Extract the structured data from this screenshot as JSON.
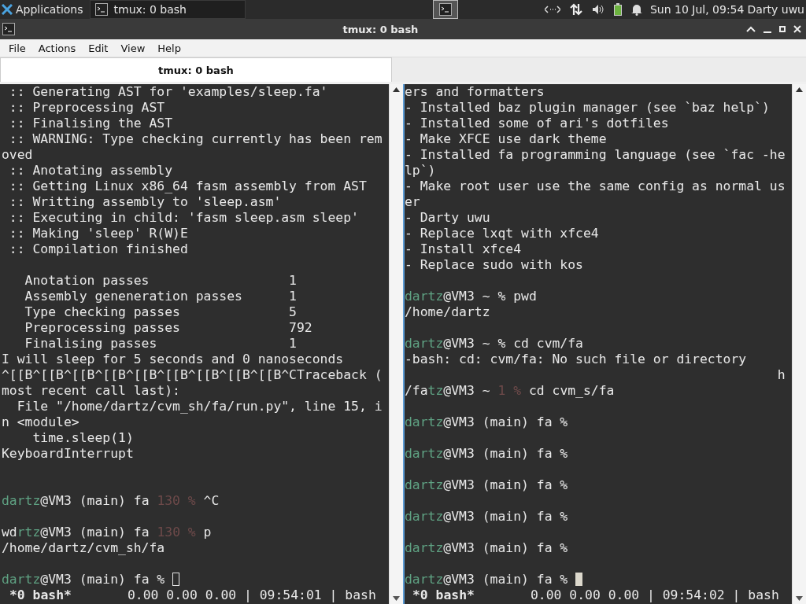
{
  "panel": {
    "apps_label": "Applications",
    "tasks": [
      {
        "label": "tmux: 0 bash"
      }
    ],
    "clock": "Sun 10 Jul, 09:54",
    "user": "Darty uwu"
  },
  "window": {
    "title": "tmux: 0 bash"
  },
  "menu": [
    "File",
    "Actions",
    "Edit",
    "View",
    "Help"
  ],
  "tabs": [
    {
      "label": "tmux: 0 bash",
      "selected": true
    }
  ],
  "panes": [
    {
      "focused": false,
      "lines": [
        {
          "segments": [
            {
              "kind": "plain",
              "text": " :: Generating AST for 'examples/sleep.fa'"
            }
          ]
        },
        {
          "segments": [
            {
              "kind": "plain",
              "text": " :: Preprocessing AST"
            }
          ]
        },
        {
          "segments": [
            {
              "kind": "plain",
              "text": " :: Finalising the AST"
            }
          ]
        },
        {
          "segments": [
            {
              "kind": "plain",
              "text": " :: WARNING: Type checking currently has been rem"
            }
          ]
        },
        {
          "segments": [
            {
              "kind": "plain",
              "text": "oved"
            }
          ]
        },
        {
          "segments": [
            {
              "kind": "plain",
              "text": " :: Anotating assembly"
            }
          ]
        },
        {
          "segments": [
            {
              "kind": "plain",
              "text": " :: Getting Linux x86_64 fasm assembly from AST"
            }
          ]
        },
        {
          "segments": [
            {
              "kind": "plain",
              "text": " :: Writting assembly to 'sleep.asm'"
            }
          ]
        },
        {
          "segments": [
            {
              "kind": "plain",
              "text": " :: Executing in child: 'fasm sleep.asm sleep'"
            }
          ]
        },
        {
          "segments": [
            {
              "kind": "plain",
              "text": " :: Making 'sleep' R(W)E"
            }
          ]
        },
        {
          "segments": [
            {
              "kind": "plain",
              "text": " :: Compilation finished"
            }
          ]
        },
        {
          "kind": "blank"
        },
        {
          "segments": [
            {
              "kind": "plain",
              "text": "   Anotation passes                  1"
            }
          ]
        },
        {
          "segments": [
            {
              "kind": "plain",
              "text": "   Assembly geneneration passes      1"
            }
          ]
        },
        {
          "segments": [
            {
              "kind": "plain",
              "text": "   Type checking passes              5"
            }
          ]
        },
        {
          "segments": [
            {
              "kind": "plain",
              "text": "   Preprocessing passes              792"
            }
          ]
        },
        {
          "segments": [
            {
              "kind": "plain",
              "text": "   Finalising passes                 1"
            }
          ]
        },
        {
          "segments": [
            {
              "kind": "plain",
              "text": "I will sleep for 5 seconds and 0 nanoseconds"
            }
          ]
        },
        {
          "segments": [
            {
              "kind": "plain",
              "text": "^[[B^[[B^[[B^[[B^[[B^[[B^[[B^[[B^[[B^CTraceback ("
            }
          ]
        },
        {
          "segments": [
            {
              "kind": "plain",
              "text": "most recent call last):"
            }
          ]
        },
        {
          "segments": [
            {
              "kind": "plain",
              "text": "  File \"/home/dartz/cvm_sh/fa/run.py\", line 15, i"
            }
          ]
        },
        {
          "segments": [
            {
              "kind": "plain",
              "text": "n <module>"
            }
          ]
        },
        {
          "segments": [
            {
              "kind": "plain",
              "text": "    time.sleep(1)"
            }
          ]
        },
        {
          "segments": [
            {
              "kind": "plain",
              "text": "KeyboardInterrupt"
            }
          ]
        },
        {
          "kind": "blank"
        },
        {
          "kind": "blank"
        },
        {
          "segments": [
            {
              "kind": "user",
              "text": "dartz"
            },
            {
              "kind": "plain",
              "text": "@VM3 (main) fa "
            },
            {
              "kind": "code",
              "text": "130 %"
            },
            {
              "kind": "plain",
              "text": " ^C"
            }
          ]
        },
        {
          "kind": "blank"
        },
        {
          "segments": [
            {
              "kind": "plain",
              "text": "wd"
            },
            {
              "kind": "user",
              "text": "rtz"
            },
            {
              "kind": "plain",
              "text": "@VM3 (main) fa "
            },
            {
              "kind": "code",
              "text": "130 %"
            },
            {
              "kind": "plain",
              "text": " p"
            }
          ]
        },
        {
          "segments": [
            {
              "kind": "plain",
              "text": "/home/dartz/cvm_sh/fa"
            }
          ]
        },
        {
          "kind": "blank"
        },
        {
          "segments": [
            {
              "kind": "user",
              "text": "dartz"
            },
            {
              "kind": "plain",
              "text": "@VM3 (main) fa % "
            }
          ],
          "cursor": true
        }
      ],
      "status": {
        "window": "*0 bash*",
        "info": "0.00 0.00 0.00 | 09:54:01 | bash"
      }
    },
    {
      "focused": true,
      "lines": [
        {
          "segments": [
            {
              "kind": "plain",
              "text": "ers and formatters"
            }
          ]
        },
        {
          "segments": [
            {
              "kind": "plain",
              "text": "- Installed baz plugin manager (see `baz help`)"
            }
          ]
        },
        {
          "segments": [
            {
              "kind": "plain",
              "text": "- Installed some of ari's dotfiles"
            }
          ]
        },
        {
          "segments": [
            {
              "kind": "plain",
              "text": "- Make XFCE use dark theme"
            }
          ]
        },
        {
          "segments": [
            {
              "kind": "plain",
              "text": "- Installed fa programming language (see `fac -he"
            }
          ]
        },
        {
          "segments": [
            {
              "kind": "plain",
              "text": "lp`)"
            }
          ]
        },
        {
          "segments": [
            {
              "kind": "plain",
              "text": "- Make root user use the same config as normal us"
            }
          ]
        },
        {
          "segments": [
            {
              "kind": "plain",
              "text": "er"
            }
          ]
        },
        {
          "segments": [
            {
              "kind": "plain",
              "text": "- Darty uwu"
            }
          ]
        },
        {
          "segments": [
            {
              "kind": "plain",
              "text": "- Replace lxqt with xfce4"
            }
          ]
        },
        {
          "segments": [
            {
              "kind": "plain",
              "text": "- Install xfce4"
            }
          ]
        },
        {
          "segments": [
            {
              "kind": "plain",
              "text": "- Replace sudo with kos"
            }
          ]
        },
        {
          "kind": "blank"
        },
        {
          "segments": [
            {
              "kind": "user",
              "text": "dartz"
            },
            {
              "kind": "plain",
              "text": "@VM3 ~ % pwd"
            }
          ]
        },
        {
          "segments": [
            {
              "kind": "plain",
              "text": "/home/dartz"
            }
          ]
        },
        {
          "kind": "blank"
        },
        {
          "segments": [
            {
              "kind": "user",
              "text": "dartz"
            },
            {
              "kind": "plain",
              "text": "@VM3 ~ % cd cvm/fa"
            }
          ]
        },
        {
          "segments": [
            {
              "kind": "plain",
              "text": "-bash: cd: cvm/fa: No such file or directory"
            }
          ]
        },
        {
          "segments": [
            {
              "kind": "plain",
              "text": "                                                h"
            }
          ]
        },
        {
          "segments": [
            {
              "kind": "plain",
              "text": "/fa"
            },
            {
              "kind": "user",
              "text": "tz"
            },
            {
              "kind": "plain",
              "text": "@VM3 ~ "
            },
            {
              "kind": "code",
              "text": "1 %"
            },
            {
              "kind": "plain",
              "text": " cd cvm_s/fa"
            }
          ]
        },
        {
          "kind": "blank"
        },
        {
          "segments": [
            {
              "kind": "user",
              "text": "dartz"
            },
            {
              "kind": "plain",
              "text": "@VM3 (main) fa %"
            }
          ]
        },
        {
          "kind": "blank"
        },
        {
          "segments": [
            {
              "kind": "user",
              "text": "dartz"
            },
            {
              "kind": "plain",
              "text": "@VM3 (main) fa %"
            }
          ]
        },
        {
          "kind": "blank"
        },
        {
          "segments": [
            {
              "kind": "user",
              "text": "dartz"
            },
            {
              "kind": "plain",
              "text": "@VM3 (main) fa %"
            }
          ]
        },
        {
          "kind": "blank"
        },
        {
          "segments": [
            {
              "kind": "user",
              "text": "dartz"
            },
            {
              "kind": "plain",
              "text": "@VM3 (main) fa %"
            }
          ]
        },
        {
          "kind": "blank"
        },
        {
          "segments": [
            {
              "kind": "user",
              "text": "dartz"
            },
            {
              "kind": "plain",
              "text": "@VM3 (main) fa %"
            }
          ]
        },
        {
          "kind": "blank"
        },
        {
          "segments": [
            {
              "kind": "user",
              "text": "dartz"
            },
            {
              "kind": "plain",
              "text": "@VM3 (main) fa % "
            }
          ],
          "cursor": true
        }
      ],
      "status": {
        "window": "*0 bash*",
        "info": "0.00 0.00 0.00 | 09:54:02 | bash"
      }
    }
  ]
}
